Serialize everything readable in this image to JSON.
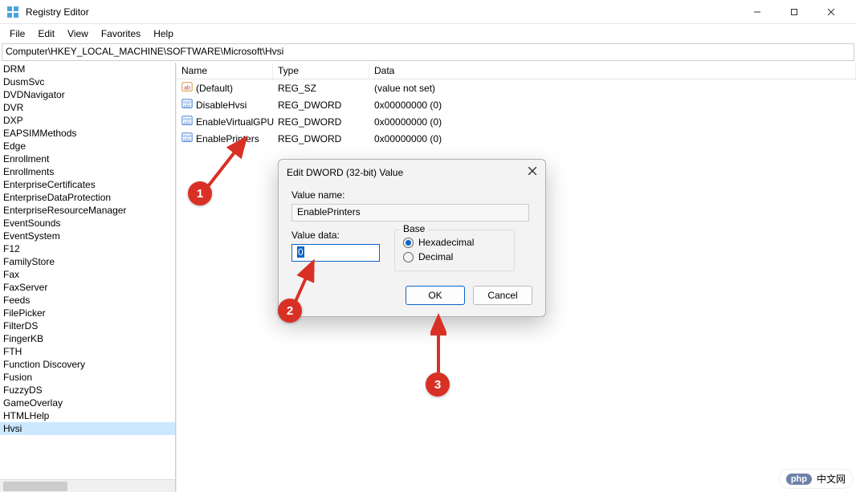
{
  "window": {
    "title": "Registry Editor",
    "controls": {
      "minimize": "–",
      "maximize": "▢",
      "close": "✕"
    }
  },
  "menu": {
    "items": [
      "File",
      "Edit",
      "View",
      "Favorites",
      "Help"
    ]
  },
  "address": "Computer\\HKEY_LOCAL_MACHINE\\SOFTWARE\\Microsoft\\Hvsi",
  "tree": {
    "items": [
      "DRM",
      "DusmSvc",
      "DVDNavigator",
      "DVR",
      "DXP",
      "EAPSIMMethods",
      "Edge",
      "Enrollment",
      "Enrollments",
      "EnterpriseCertificates",
      "EnterpriseDataProtection",
      "EnterpriseResourceManager",
      "EventSounds",
      "EventSystem",
      "F12",
      "FamilyStore",
      "Fax",
      "FaxServer",
      "Feeds",
      "FilePicker",
      "FilterDS",
      "FingerKB",
      "FTH",
      "Function Discovery",
      "Fusion",
      "FuzzyDS",
      "GameOverlay",
      "HTMLHelp",
      "Hvsi"
    ],
    "selected": "Hvsi"
  },
  "list": {
    "headers": {
      "name": "Name",
      "type": "Type",
      "data": "Data"
    },
    "rows": [
      {
        "icon": "string",
        "name": "(Default)",
        "type": "REG_SZ",
        "data": "(value not set)"
      },
      {
        "icon": "dword",
        "name": "DisableHvsi",
        "type": "REG_DWORD",
        "data": "0x00000000 (0)"
      },
      {
        "icon": "dword",
        "name": "EnableVirtualGPU",
        "type": "REG_DWORD",
        "data": "0x00000000 (0)"
      },
      {
        "icon": "dword",
        "name": "EnablePrinters",
        "type": "REG_DWORD",
        "data": "0x00000000 (0)"
      }
    ]
  },
  "dialog": {
    "title": "Edit DWORD (32-bit) Value",
    "value_name_label": "Value name:",
    "value_name": "EnablePrinters",
    "value_data_label": "Value data:",
    "value_data": "0",
    "base_label": "Base",
    "radio_hex": "Hexadecimal",
    "radio_dec": "Decimal",
    "ok": "OK",
    "cancel": "Cancel"
  },
  "annotations": {
    "b1": "1",
    "b2": "2",
    "b3": "3"
  },
  "watermark": {
    "pill": "php",
    "text": "中文网"
  }
}
